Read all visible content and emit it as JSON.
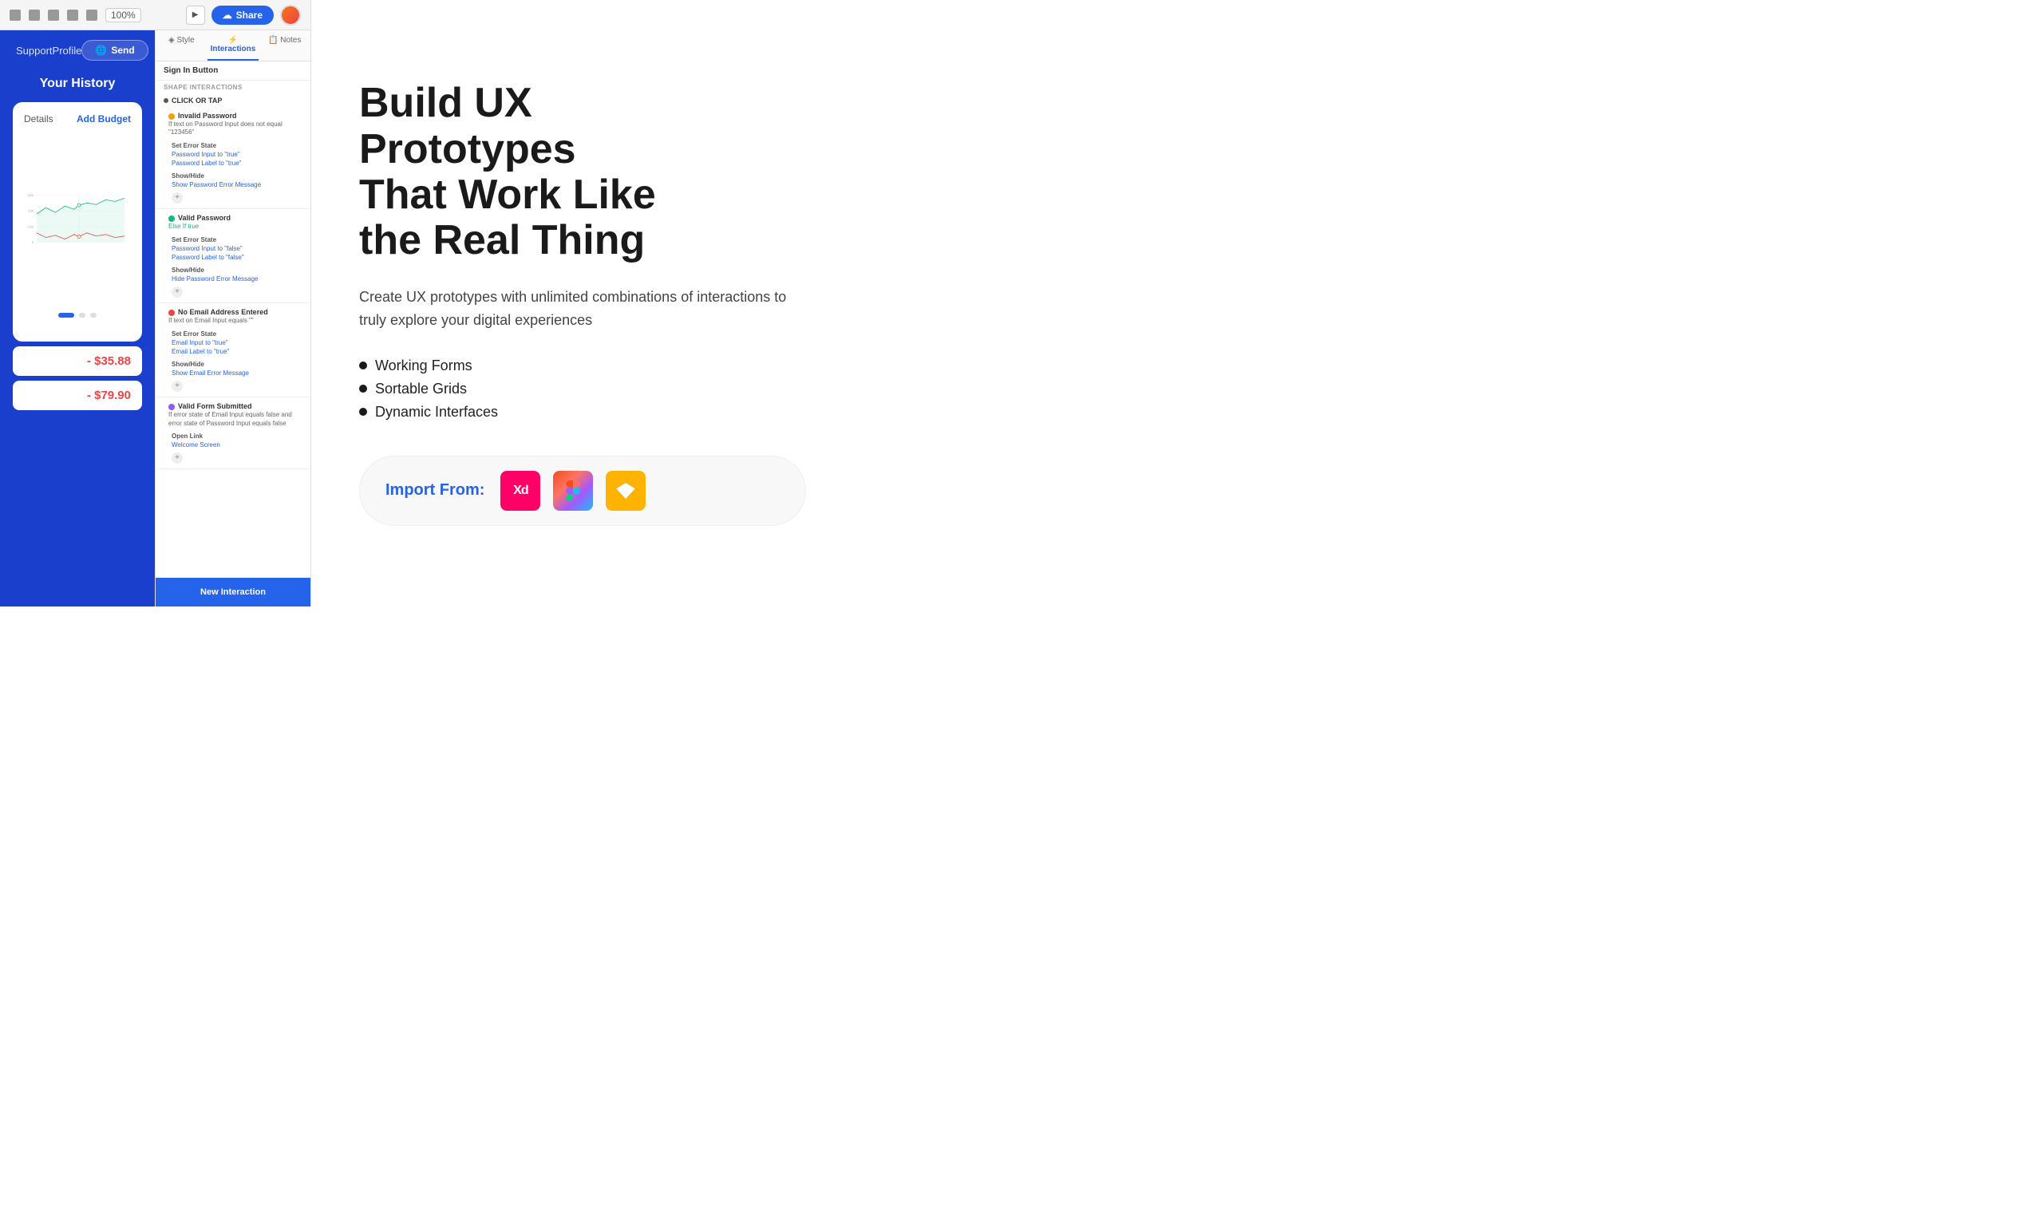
{
  "toolbar": {
    "zoom": "100%",
    "share_label": "Share",
    "play_icon": "▶"
  },
  "app": {
    "nav": {
      "support": "Support",
      "profile": "Profile",
      "send": "Send"
    },
    "history_title": "Your History",
    "chart": {
      "title": "Details",
      "add_budget": "Add Budget",
      "y_labels": [
        "3,00",
        "2,00",
        "1,00",
        "0"
      ]
    },
    "transactions": [
      {
        "amount": "- $35.88"
      },
      {
        "amount": "- $79.90"
      }
    ]
  },
  "interactions_panel": {
    "tabs": [
      {
        "label": "Style",
        "icon": "◈",
        "active": false
      },
      {
        "label": "Interactions",
        "icon": "⚡",
        "active": true
      },
      {
        "label": "Notes",
        "icon": "📝",
        "active": false
      }
    ],
    "element_name": "Sign In Button",
    "section_label": "SHAPE INTERACTIONS",
    "trigger": "CLICK OR TAP",
    "conditions": [
      {
        "color": "#f59e0b",
        "name": "Invalid Password",
        "text": "If text on Password Input does not equal \"123456\"",
        "actions": [
          {
            "type": "Set Error State",
            "values": [
              "Password Input to \"true\"",
              "Password Label to \"true\""
            ]
          },
          {
            "type": "Show/Hide",
            "values": [
              "Show Password Error Message"
            ]
          }
        ]
      },
      {
        "color": "#10b981",
        "name": "Valid Password",
        "text": "Else If true",
        "actions": [
          {
            "type": "Set Error State",
            "values": [
              "Password Input to \"false\"",
              "Password Label to \"false\""
            ]
          },
          {
            "type": "Show/Hide",
            "values": [
              "Hide Password Error Message"
            ]
          }
        ]
      },
      {
        "color": "#ef4444",
        "name": "No Email Address Entered",
        "text": "If text on Email Input equals \"\"",
        "actions": [
          {
            "type": "Set Error State",
            "values": [
              "Email Input to \"true\"",
              "Email Label to \"true\""
            ]
          },
          {
            "type": "Show/Hide",
            "values": [
              "Show Email Error Message"
            ]
          }
        ]
      },
      {
        "color": "#8b5cf6",
        "name": "Valid Form Submitted",
        "text": "If error state of Email Input equals false and error state of Password Input equals false",
        "actions": [
          {
            "type": "Open Link",
            "values": [
              "Welcome Screen"
            ]
          }
        ]
      }
    ],
    "new_interaction_label": "New Interaction"
  },
  "marketing": {
    "headline_line1": "Build UX",
    "headline_line2": "Prototypes",
    "headline_line3": "That Work Like",
    "headline_line4": "the Real Thing",
    "subtitle": "Create UX prototypes with unlimited combinations of interactions to truly explore your digital experiences",
    "features": [
      "Working Forms",
      "Sortable Grids",
      "Dynamic Interfaces"
    ],
    "import_label": "Import From:",
    "import_apps": [
      "XD",
      "Figma",
      "Sketch"
    ]
  }
}
